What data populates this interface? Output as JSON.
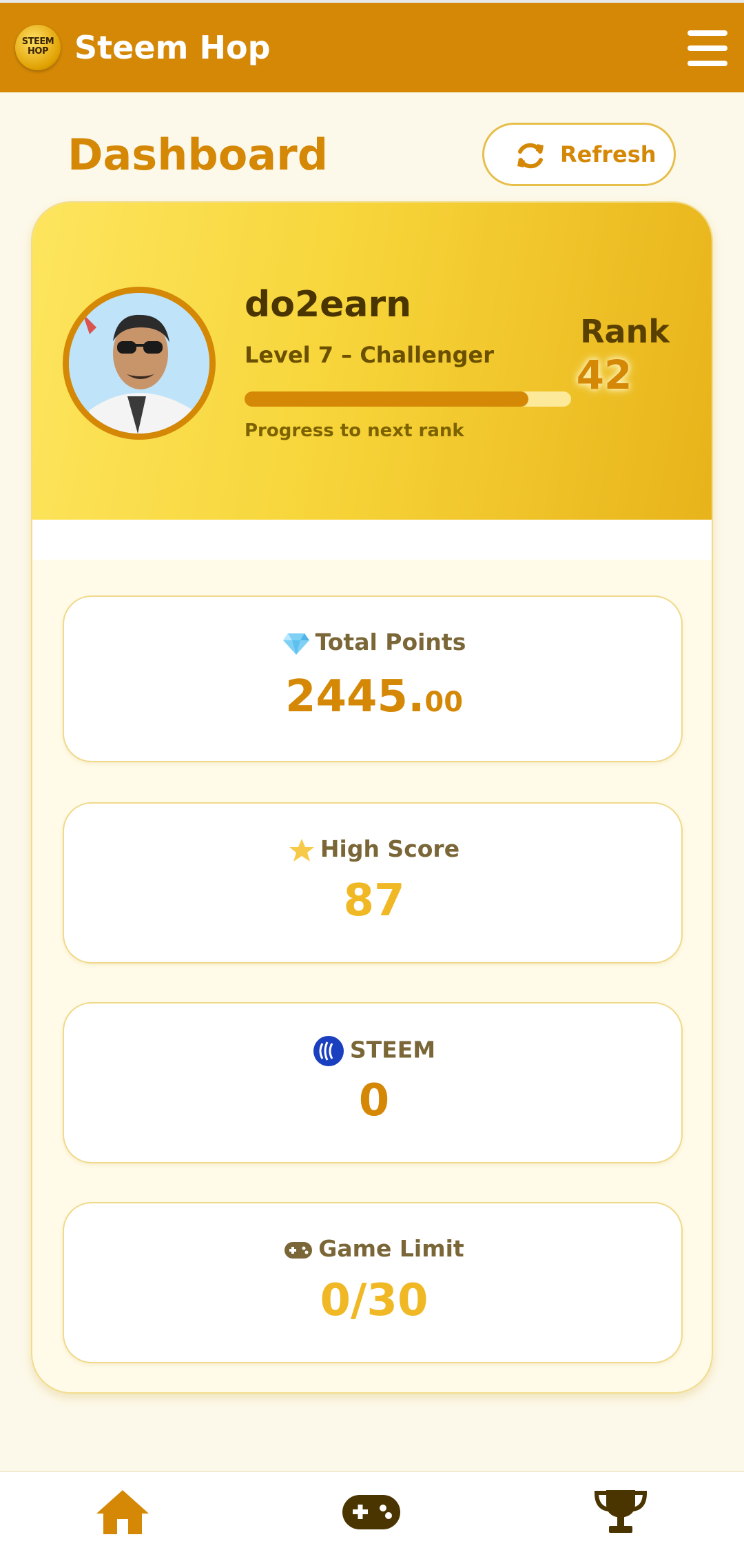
{
  "header": {
    "logo_text": "STEEM HOP",
    "app_title": "Steem Hop"
  },
  "dashboard": {
    "title": "Dashboard",
    "refresh_label": "Refresh"
  },
  "profile": {
    "username": "do2earn",
    "level": "Level 7 – Challenger",
    "progress_fraction": 0.87,
    "progress_label": "Progress to next rank",
    "rank_label": "Rank",
    "rank_value": "42"
  },
  "stats": {
    "total_points": {
      "label": "Total Points",
      "value_int": "2445.",
      "value_dec": "00",
      "icon": "gem-icon"
    },
    "high_score": {
      "label": "High Score",
      "value": "87",
      "icon": "star-icon"
    },
    "steem": {
      "label": "STEEM",
      "value": "0",
      "icon": "steem-logo-icon"
    },
    "game_limit": {
      "label": "Game Limit",
      "value": "0/30",
      "icon": "gamepad-icon"
    }
  },
  "colors": {
    "primary": "#d48806",
    "accent_gold": "#f0b825",
    "hero_light": "#fde55e",
    "background": "#fdf9ea"
  },
  "bottom_nav": {
    "items": [
      "home-icon",
      "gamepad-icon",
      "trophy-icon"
    ]
  }
}
